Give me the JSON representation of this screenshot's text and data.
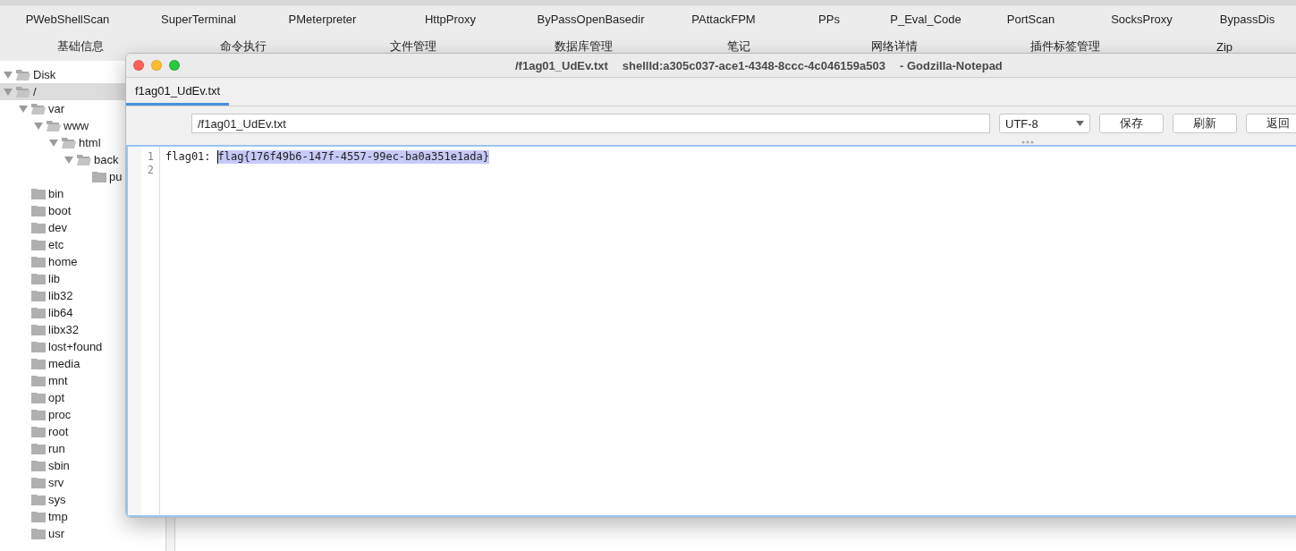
{
  "plugin_tabs": [
    "PWebShellScan",
    "SuperTerminal",
    "PMeterpreter",
    "HttpProxy",
    "ByPassOpenBasedir",
    "PAttackFPM",
    "PPs",
    "P_Eval_Code",
    "PortScan",
    "SocksProxy",
    "BypassDis"
  ],
  "main_tabs": [
    "基础信息",
    "命令执行",
    "文件管理",
    "数据库管理",
    "笔记",
    "网络详情",
    "插件标签管理",
    "Zip"
  ],
  "file_tree": [
    {
      "label": "Disk",
      "expanded": true,
      "selected": false,
      "children": [
        {
          "label": "/",
          "expanded": true,
          "selected": true,
          "children": [
            {
              "label": "var",
              "expanded": true,
              "selected": false,
              "children": [
                {
                  "label": "www",
                  "expanded": true,
                  "selected": false,
                  "children": [
                    {
                      "label": "html",
                      "expanded": true,
                      "selected": false,
                      "children": [
                        {
                          "label": "back",
                          "expanded": true,
                          "selected": false,
                          "children": [
                            {
                              "label": "pu",
                              "expanded": false,
                              "selected": false
                            }
                          ]
                        }
                      ]
                    }
                  ]
                }
              ]
            },
            {
              "label": "bin",
              "expanded": false,
              "selected": false
            },
            {
              "label": "boot",
              "expanded": false,
              "selected": false
            },
            {
              "label": "dev",
              "expanded": false,
              "selected": false
            },
            {
              "label": "etc",
              "expanded": false,
              "selected": false
            },
            {
              "label": "home",
              "expanded": false,
              "selected": false
            },
            {
              "label": "lib",
              "expanded": false,
              "selected": false
            },
            {
              "label": "lib32",
              "expanded": false,
              "selected": false
            },
            {
              "label": "lib64",
              "expanded": false,
              "selected": false
            },
            {
              "label": "libx32",
              "expanded": false,
              "selected": false
            },
            {
              "label": "lost+found",
              "expanded": false,
              "selected": false
            },
            {
              "label": "media",
              "expanded": false,
              "selected": false
            },
            {
              "label": "mnt",
              "expanded": false,
              "selected": false
            },
            {
              "label": "opt",
              "expanded": false,
              "selected": false
            },
            {
              "label": "proc",
              "expanded": false,
              "selected": false
            },
            {
              "label": "root",
              "expanded": false,
              "selected": false
            },
            {
              "label": "run",
              "expanded": false,
              "selected": false
            },
            {
              "label": "sbin",
              "expanded": false,
              "selected": false
            },
            {
              "label": "srv",
              "expanded": false,
              "selected": false
            },
            {
              "label": "sys",
              "expanded": false,
              "selected": false
            },
            {
              "label": "tmp",
              "expanded": false,
              "selected": false
            },
            {
              "label": "usr",
              "expanded": false,
              "selected": false
            }
          ]
        }
      ]
    }
  ],
  "notepad": {
    "title": [
      "/f1ag01_UdEv.txt",
      "shellId:a305c037-ace1-4348-8ccc-4c046159a503",
      "- Godzilla-Notepad"
    ],
    "tabs": [
      {
        "label": "f1ag01_UdEv.txt",
        "selected": true
      }
    ],
    "path": "/f1ag01_UdEv.txt",
    "encoding": "UTF-8",
    "buttons": [
      "保存",
      "刷新",
      "返回"
    ],
    "lines": [
      {
        "number": "1",
        "text": "flag01:",
        "selection": "flag{176f49b6-147f-4557-99ec-ba0a351e1ada}"
      },
      {
        "number": "2"
      }
    ]
  }
}
